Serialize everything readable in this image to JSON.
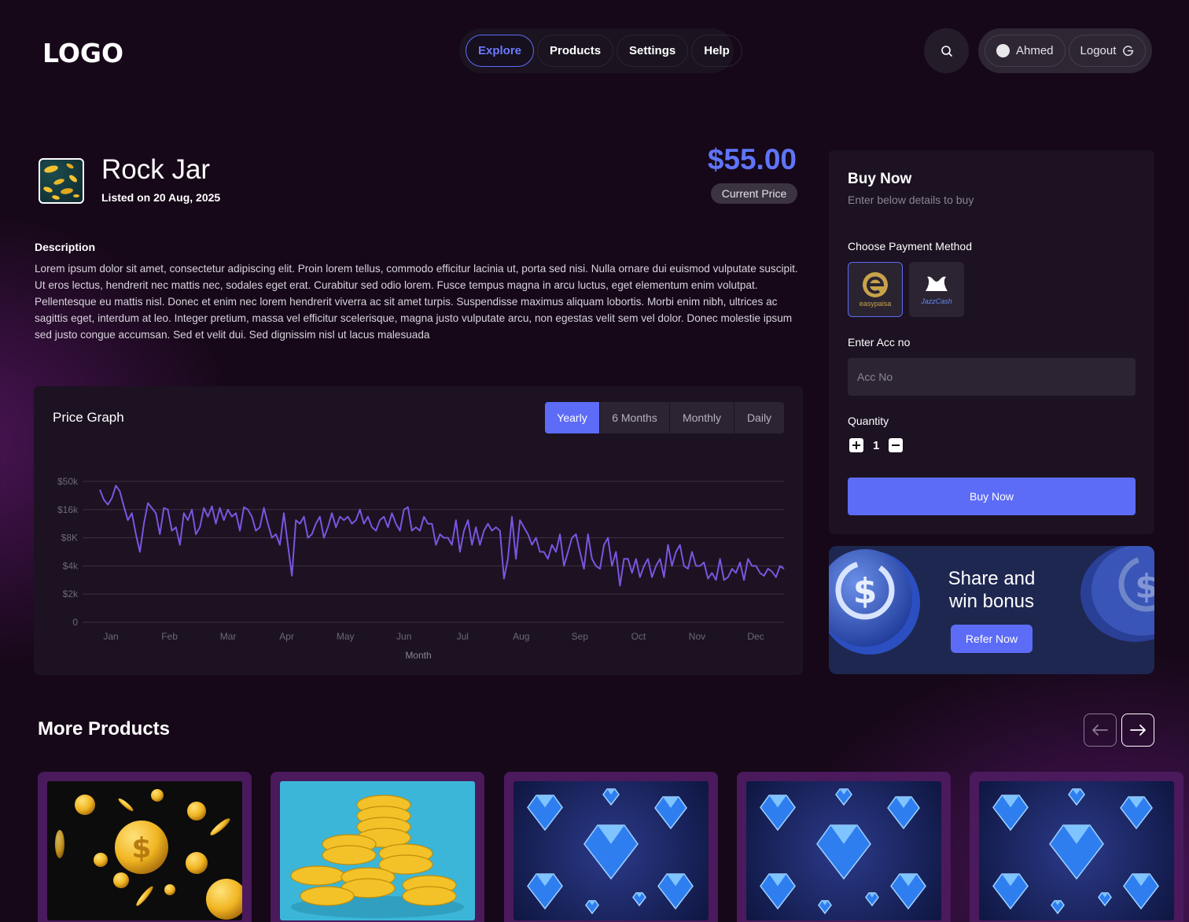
{
  "header": {
    "logo": "LOGO",
    "nav": [
      "Explore",
      "Products",
      "Settings",
      "Help"
    ],
    "user_name": "Ahmed",
    "logout_label": "Logout"
  },
  "product": {
    "title": "Rock Jar",
    "listed": "Listed on 20 Aug, 2025",
    "price": "$55.00",
    "price_label": "Current Price",
    "description_heading": "Description",
    "description": "Lorem ipsum dolor sit amet, consectetur adipiscing elit. Proin lorem tellus, commodo efficitur lacinia ut, porta sed nisi. Nulla ornare dui euismod vulputate suscipit. Ut eros lectus, hendrerit nec mattis nec, sodales eget erat. Curabitur sed odio lorem. Fusce tempus magna in arcu luctus, eget elementum enim volutpat. Pellentesque eu mattis nisl. Donec et enim nec lorem hendrerit viverra ac sit amet turpis. Suspendisse maximus aliquam lobortis. Morbi enim nibh, ultrices ac sagittis eget, interdum at leo. Integer pretium, massa vel efficitur scelerisque, magna justo vulputate arcu, non egestas velit sem vel dolor. Donec molestie ipsum sed justo congue accumsan. Sed et velit dui. Sed dignissim nisl ut lacus malesuada"
  },
  "graph": {
    "title": "Price Graph",
    "tabs": [
      "Yearly",
      "6 Months",
      "Monthly",
      "Daily"
    ],
    "active_tab": "Yearly"
  },
  "chart_data": {
    "type": "line",
    "title": "Price Graph",
    "xlabel": "Month",
    "ylabel": "",
    "x_ticks": [
      "Jan",
      "Feb",
      "Mar",
      "Apr",
      "May",
      "Jun",
      "Jul",
      "Aug",
      "Sep",
      "Oct",
      "Nov",
      "Dec"
    ],
    "y_ticks": [
      "0",
      "$2k",
      "$4k",
      "$8K",
      "$16k",
      "$50k"
    ],
    "y_tick_values": [
      0,
      2000,
      4000,
      8000,
      16000,
      50000
    ],
    "grid": true,
    "line_color": "#7b55e0",
    "series": [
      {
        "values": [
          40000,
          28000,
          22000,
          30000,
          45000,
          38000,
          20000,
          13000,
          15000,
          9000,
          6000,
          12000,
          24000,
          18000,
          15000,
          9000,
          18000,
          16000,
          10000,
          11000,
          7000,
          15000,
          13000,
          16000,
          9000,
          11000,
          18000,
          14000,
          20000,
          12000,
          18000,
          13000,
          16000,
          14000,
          15000,
          10000,
          19000,
          16000,
          14000,
          10000,
          11000,
          18000,
          12000,
          8000,
          9000,
          7000,
          15000,
          7000,
          3300,
          13000,
          12000,
          14000,
          8000,
          9000,
          12000,
          14000,
          8000,
          11000,
          15000,
          11000,
          14000,
          13000,
          14000,
          12000,
          13000,
          16000,
          12000,
          14000,
          11000,
          10000,
          13000,
          14000,
          11000,
          15000,
          12000,
          10000,
          16000,
          19000,
          10000,
          11000,
          10000,
          14000,
          12000,
          12000,
          7000,
          9000,
          8000,
          8000,
          7000,
          13000,
          6000,
          10000,
          13000,
          7000,
          11000,
          7000,
          10000,
          12000,
          10000,
          11000,
          10000,
          3100,
          5000,
          14000,
          5000,
          13000,
          11000,
          9000,
          7000,
          8000,
          6000,
          6000,
          5000,
          7000,
          6000,
          9000,
          4000,
          6000,
          8000,
          9000,
          6000,
          3800,
          9000,
          5000,
          4000,
          3800,
          7000,
          8000,
          4000,
          6000,
          2600,
          5000,
          5000,
          3500,
          5000,
          3200,
          4000,
          5000,
          3200,
          4000,
          5000,
          3200,
          7000,
          4000,
          6000,
          7000,
          4000,
          3800,
          6000,
          4000,
          4000,
          4500,
          3100,
          3500,
          3000,
          5000,
          3000,
          3200,
          3800,
          3500,
          4500,
          3000,
          5000,
          4000,
          4000,
          3500,
          3300,
          3800,
          3600,
          3200,
          4000,
          3800
        ]
      }
    ]
  },
  "buy": {
    "title": "Buy Now",
    "subtitle": "Enter below details to buy",
    "payment_label": "Choose Payment Method",
    "methods": [
      "easypaisa",
      "JazzCash"
    ],
    "selected_method": "easypaisa",
    "acc_label": "Enter Acc no",
    "acc_placeholder": "Acc No",
    "acc_value": "",
    "qty_label": "Quantity",
    "qty_value": "1",
    "button": "Buy Now"
  },
  "refer": {
    "line1": "Share and",
    "line2": "win bonus",
    "button": "Refer Now"
  },
  "more": {
    "heading": "More Products",
    "items": [
      {
        "image": "floating-gold-coins"
      },
      {
        "image": "gold-coin-stacks"
      },
      {
        "image": "blue-gems"
      },
      {
        "image": "blue-gems"
      },
      {
        "image": "blue-gems"
      }
    ]
  },
  "colors": {
    "accent": "#5d6cf7",
    "price": "#5f74f9",
    "card_bg": "#1c1221",
    "page_bg": "#160818"
  }
}
